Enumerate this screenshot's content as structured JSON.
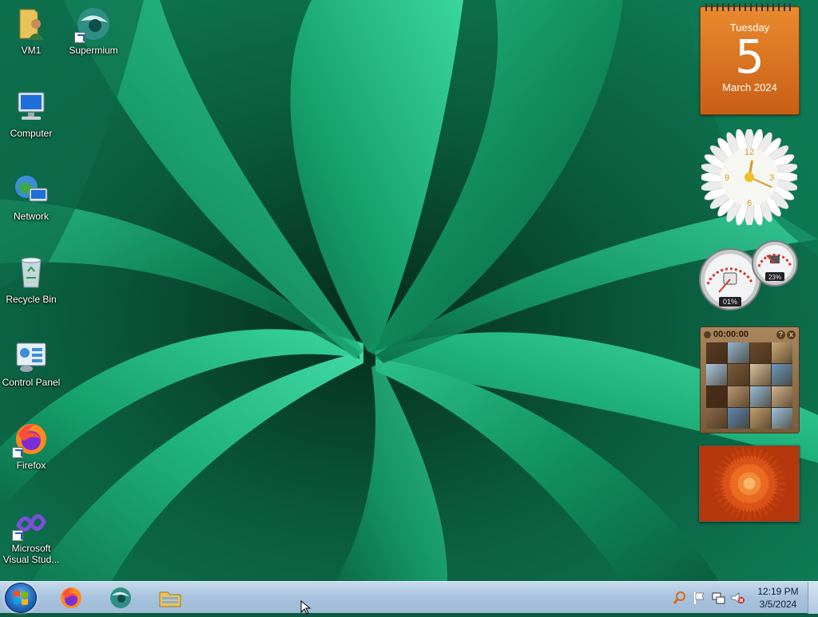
{
  "desktop": {
    "icons": [
      {
        "label": "VM1",
        "icon": "user-folder-icon"
      },
      {
        "label": "Supermium",
        "icon": "supermium-icon"
      },
      {
        "label": "Computer",
        "icon": "computer-icon"
      },
      {
        "label": "Network",
        "icon": "network-icon"
      },
      {
        "label": "Recycle Bin",
        "icon": "recycle-bin-icon"
      },
      {
        "label": "Control Panel",
        "icon": "control-panel-icon"
      },
      {
        "label": "Firefox",
        "icon": "firefox-icon"
      },
      {
        "label": "Microsoft Visual Stud...",
        "label_line1": "Microsoft",
        "label_line2": "Visual Stud...",
        "icon": "visual-studio-icon"
      }
    ]
  },
  "gadgets": {
    "calendar": {
      "weekday": "Tuesday",
      "day": "5",
      "month_year": "March 2024"
    },
    "clock": {
      "hour": 12,
      "minute": 19,
      "numerals": [
        "12",
        "3",
        "6",
        "9"
      ]
    },
    "cpu_meter": {
      "cpu": "01%",
      "memory": "23%"
    },
    "puzzle": {
      "timer": "00:00:00",
      "help": "?",
      "close": "x"
    },
    "slideshow": {
      "subject": "orange-chrysanthemum"
    }
  },
  "taskbar": {
    "start_label": "Start",
    "pinned": [
      {
        "name": "Firefox",
        "icon": "firefox-icon"
      },
      {
        "name": "Supermium",
        "icon": "supermium-icon"
      },
      {
        "name": "File Explorer",
        "icon": "folder-icon"
      }
    ],
    "tray": {
      "time": "12:19 PM",
      "date": "3/5/2024"
    }
  },
  "colors": {
    "taskbar": "#a8c2dd",
    "calendar": "#e07a26",
    "wallpaper_green": "#0f8f63"
  }
}
